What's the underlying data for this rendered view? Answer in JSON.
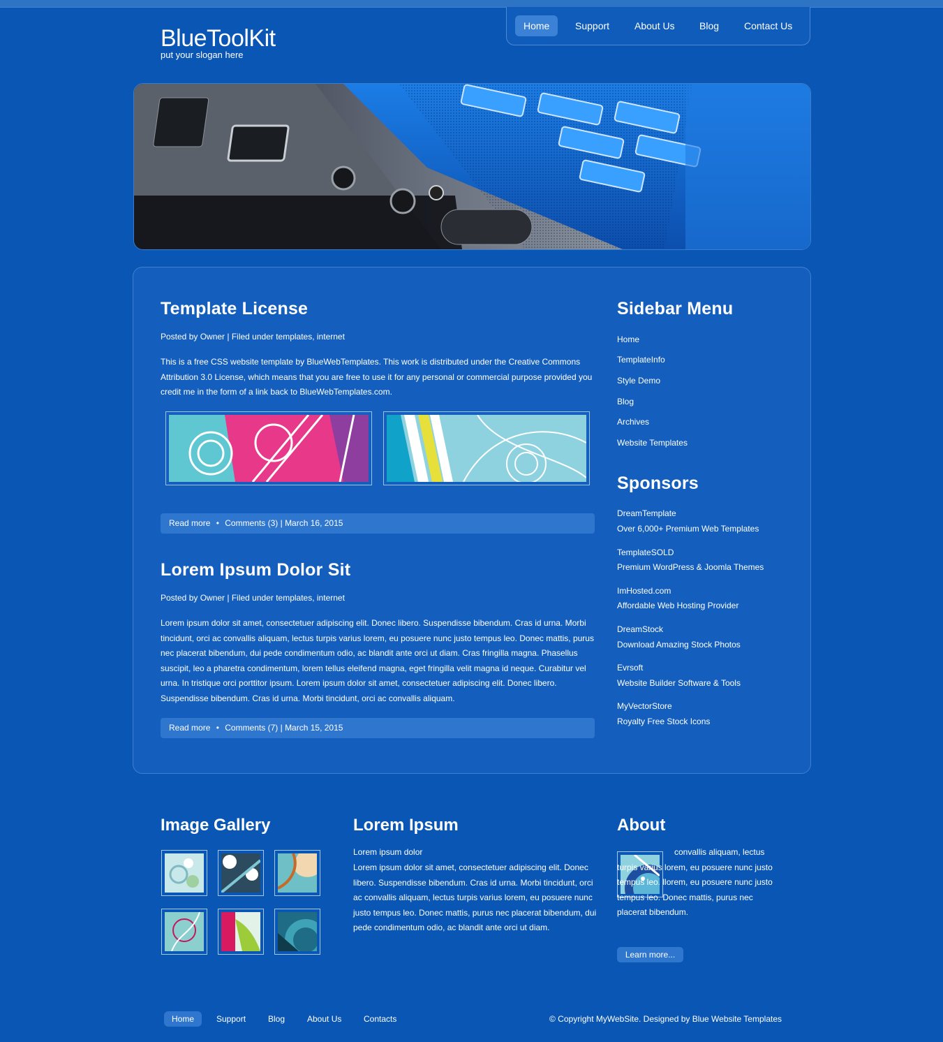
{
  "logo": {
    "name": "BlueToolKit",
    "slogan": "put your slogan here"
  },
  "nav": [
    "Home",
    "Support",
    "About Us",
    "Blog",
    "Contact Us"
  ],
  "posts": [
    {
      "title": "Template License",
      "meta": "Posted by Owner | Filed under templates, internet",
      "body": "This is a free CSS website template by BlueWebTemplates. This work is distributed under the Creative Commons Attribution 3.0 License, which means that you are free to use it for any personal or commercial purpose provided you credit me in the form of a link back to BlueWebTemplates.com.",
      "read_more": "Read more",
      "comments": "Comments (3) | March 16, 2015"
    },
    {
      "title": "Lorem Ipsum Dolor Sit",
      "meta": "Posted by Owner | Filed under templates, internet",
      "body": "Lorem ipsum dolor sit amet, consectetuer adipiscing elit. Donec libero. Suspendisse bibendum. Cras id urna. Morbi tincidunt, orci ac convallis aliquam, lectus turpis varius lorem, eu posuere nunc justo tempus leo. Donec mattis, purus nec placerat bibendum, dui pede condimentum odio, ac blandit ante orci ut diam. Cras fringilla magna. Phasellus suscipit, leo a pharetra condimentum, lorem tellus eleifend magna, eget fringilla velit magna id neque. Curabitur vel urna. In tristique orci porttitor ipsum. Lorem ipsum dolor sit amet, consectetuer adipiscing elit. Donec libero. Suspendisse bibendum. Cras id urna. Morbi tincidunt, orci ac convallis aliquam.",
      "read_more": "Read more",
      "comments": "Comments (7) | March 15, 2015"
    }
  ],
  "sidebar": {
    "title": "Sidebar Menu",
    "items": [
      "Home",
      "TemplateInfo",
      "Style Demo",
      "Blog",
      "Archives",
      "Website Templates"
    ]
  },
  "sponsors": {
    "title": "Sponsors",
    "items": [
      {
        "name": "DreamTemplate",
        "desc": "Over 6,000+ Premium Web Templates"
      },
      {
        "name": "TemplateSOLD",
        "desc": "Premium WordPress & Joomla Themes"
      },
      {
        "name": "ImHosted.com",
        "desc": "Affordable Web Hosting Provider"
      },
      {
        "name": "DreamStock",
        "desc": "Download Amazing Stock Photos"
      },
      {
        "name": "Evrsoft",
        "desc": "Website Builder Software & Tools"
      },
      {
        "name": "MyVectorStore",
        "desc": "Royalty Free Stock Icons"
      }
    ]
  },
  "gallery": {
    "title": "Image Gallery"
  },
  "lorem": {
    "title": "Lorem Ipsum",
    "line1": "Lorem ipsum dolor",
    "body": "Lorem ipsum dolor sit amet, consectetuer adipiscing elit. Donec libero. Suspendisse bibendum. Cras id urna. Morbi tincidunt, orci ac convallis aliquam, lectus turpis varius lorem, eu posuere nunc justo tempus leo. Donec mattis, purus nec placerat bibendum, dui pede condimentum odio, ac blandit ante orci ut diam."
  },
  "about": {
    "title": "About",
    "body": "convallis aliquam, lectus turpis varius lorem, eu posuere nunc justo tempus leo. llorem, eu posuere nunc justo tempus leo. Donec mattis, purus nec placerat bibendum.",
    "button": "Learn more..."
  },
  "footer": {
    "nav": [
      "Home",
      "Support",
      "Blog",
      "About Us",
      "Contacts"
    ],
    "copyright": "© Copyright MyWebSite. Designed by Blue Website Templates"
  },
  "colors": {
    "background": "#0a56b4",
    "panel": "#145fbd",
    "accent": "#2f76cf"
  }
}
